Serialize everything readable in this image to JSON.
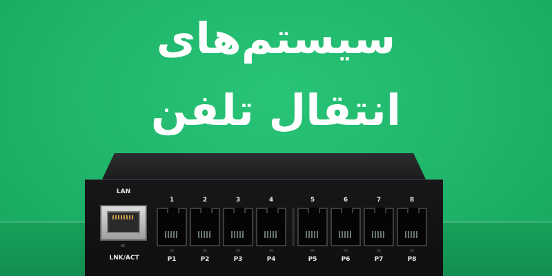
{
  "banner": {
    "title_line1": "سیستم‌های",
    "title_line2": "انتقال تلفن",
    "background_color": "#1fb56a",
    "text_color": "#ffffff"
  },
  "device": {
    "lan_label": "LAN",
    "lnk_act_label": "LNK/ACT",
    "ports": [
      {
        "number": "1",
        "label": "P1"
      },
      {
        "number": "2",
        "label": "P2"
      },
      {
        "number": "3",
        "label": "P3"
      },
      {
        "number": "4",
        "label": "P4"
      },
      {
        "number": "5",
        "label": "P5"
      },
      {
        "number": "6",
        "label": "P6"
      },
      {
        "number": "7",
        "label": "P7"
      },
      {
        "number": "8",
        "label": "P8"
      }
    ]
  }
}
